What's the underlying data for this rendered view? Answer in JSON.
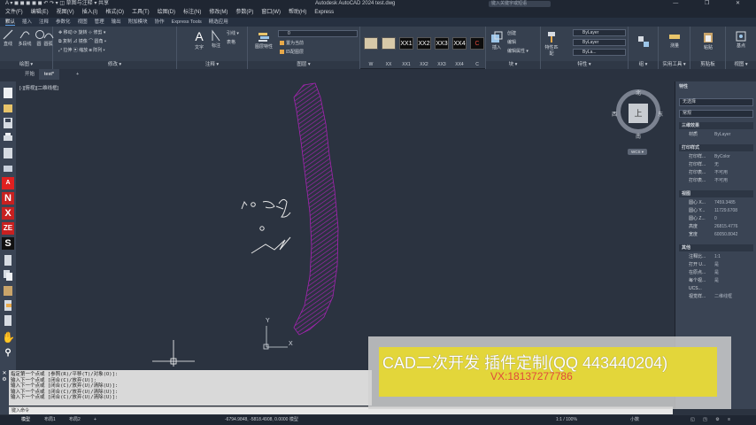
{
  "title_bar": {
    "quick_access": "A ▾  ◼ ◼ ◼ ◼ ◼  ↶ ↷  ▾   ◫ 草图与注释  ▾  共享",
    "app_title": "Autodesk AutoCAD 2024    test.dwg",
    "search_placeholder": "键入关键字或短语",
    "window_controls": "— ❐ ✕"
  },
  "menu_bar": [
    "文件(F)",
    "编辑(E)",
    "视图(V)",
    "插入(I)",
    "格式(O)",
    "工具(T)",
    "绘图(D)",
    "标注(N)",
    "修改(M)",
    "参数(P)",
    "窗口(W)",
    "帮助(H)",
    "Express"
  ],
  "ribbon_tabs": [
    "默认",
    "插入",
    "注释",
    "参数化",
    "视图",
    "管理",
    "输出",
    "附加模块",
    "协作",
    "Express Tools",
    "精选应用"
  ],
  "ribbon_active_tab": "默认",
  "ribbon": {
    "draw": {
      "label": "绘图 ▾",
      "buttons": [
        "直线",
        "多段线",
        "圆",
        "圆弧"
      ]
    },
    "modify": {
      "label": "修改 ▾",
      "rows": [
        "✥ 移动  ⟳ 旋转  ⊹ 修剪 ▾",
        "⧉ 复制  ⊿ 镜像  ⌒ 圆角 ▾",
        "⤢ 拉伸  ▣ 缩放  ⊞ 阵列 ▾"
      ]
    },
    "annotation": {
      "label": "注释 ▾",
      "buttons": [
        "文字",
        "标注"
      ],
      "rows": [
        "引线 ▾",
        "表格"
      ]
    },
    "layers": {
      "label": "图层 ▾",
      "button": "图层特性",
      "dropdown": "0",
      "rows": [
        "置为当前",
        "匹配图层"
      ]
    },
    "blocks": {
      "thumbs": [
        "W",
        "XX",
        "XX1",
        "XX2",
        "XX3",
        "XX4",
        "C"
      ]
    },
    "insert": {
      "label": "块 ▾",
      "button": "插入",
      "rows": [
        "创建",
        "编辑",
        "编辑属性 ▾"
      ]
    },
    "properties": {
      "label": "特性 ▾",
      "button": "特性匹配",
      "rows": [
        "ByLayer",
        "ByLayer",
        "ByLa..."
      ]
    },
    "groups": {
      "label": "组 ▾"
    },
    "utilities": {
      "label": "实用工具 ▾",
      "button": "测量"
    },
    "clipboard": {
      "label": "剪贴板",
      "button": "粘贴"
    },
    "view": {
      "label": "视图 ▾",
      "button": "基点"
    }
  },
  "file_tabs": [
    "开始",
    "test*",
    "+"
  ],
  "viewport_label": "[-][俯视][二维线框]",
  "viewcube": {
    "face": "上",
    "north": "北",
    "south": "南",
    "east": "东",
    "west": "西",
    "wcs": "WCS ▾"
  },
  "properties_palette": {
    "title": "特性",
    "selection": "无选择",
    "general_section": "常规",
    "sections": [
      {
        "name": "三维效果",
        "rows": [
          {
            "key": "材质",
            "value": "ByLayer"
          }
        ]
      },
      {
        "name": "打印样式",
        "rows": [
          {
            "key": "打印样...",
            "value": "ByColor"
          },
          {
            "key": "打印样...",
            "value": "无"
          },
          {
            "key": "打印表...",
            "value": "不可用"
          },
          {
            "key": "打印表...",
            "value": "不可用"
          }
        ]
      },
      {
        "name": "视图",
        "rows": [
          {
            "key": "圆心 X...",
            "value": "7459.3485"
          },
          {
            "key": "圆心 Y...",
            "value": "11729.6708"
          },
          {
            "key": "圆心 Z...",
            "value": "0"
          },
          {
            "key": "高度",
            "value": "26815.4776"
          },
          {
            "key": "宽度",
            "value": "60050.8042"
          }
        ]
      },
      {
        "name": "其他",
        "rows": [
          {
            "key": "注释比...",
            "value": "1:1"
          },
          {
            "key": "打开 U...",
            "value": "是"
          },
          {
            "key": "在原点...",
            "value": "是"
          },
          {
            "key": "每个视...",
            "value": "是"
          },
          {
            "key": "UCS...",
            "value": ""
          },
          {
            "key": "视觉样...",
            "value": "二维线框"
          }
        ]
      }
    ]
  },
  "command_history": [
    "指定第一个点或 [参照(R)/平移(T)/对象(O)]:",
    "输入下一个点或 [闭合(C)/放弃(U)]:",
    "输入下一个点或 [闭合(C)/放弃(U)/清除(U)]:",
    "输入下一个点或 [闭合(C)/放弃(U)/清除(U)]:",
    "输入下一个点或 [闭合(C)/放弃(U)/清除(U)]:"
  ],
  "command_input_placeholder": "键入命令",
  "status_bar": {
    "layout_tabs": [
      "模型",
      "布局1",
      "布局2",
      "+"
    ],
    "coords": "-6794.9848, -5818.4908, 0.0000  模型",
    "scale": "1:1 / 100%",
    "units": "小数"
  },
  "ucs_icon": {
    "x_label": "X",
    "y_label": "Y"
  },
  "watermark": {
    "line1": "CAD二次开发 插件定制(QQ 443440204)",
    "line2": "VX:18137277786"
  },
  "colors": {
    "hatch": "#a424b0",
    "sketch": "#e6e6e6",
    "canvas": "#2b3340",
    "watermark_yellow": "#e3d63a",
    "watermark_red": "#e04a3c"
  }
}
